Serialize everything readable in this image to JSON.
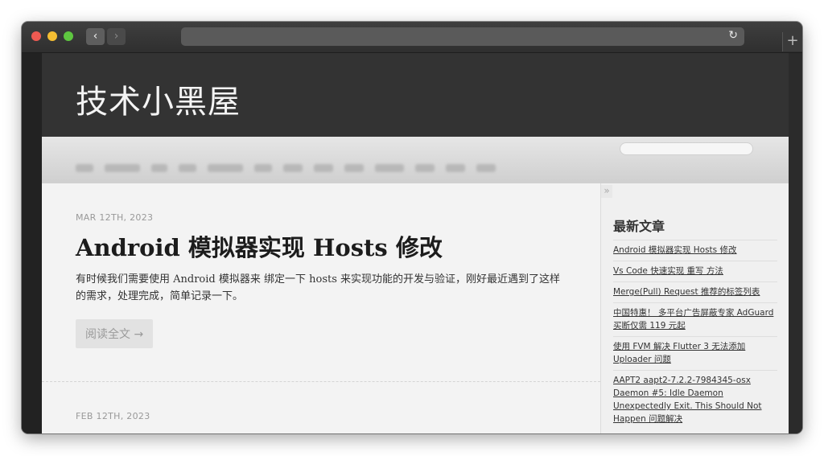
{
  "browser": {
    "back_glyph": "‹",
    "forward_glyph": "›",
    "reload_glyph": "↻",
    "new_tab_glyph": "+",
    "address": ""
  },
  "site": {
    "title": "技术小黑屋"
  },
  "posts": [
    {
      "date": "MAR 12TH, 2023",
      "title": "Android 模拟器实现 Hosts 修改",
      "excerpt": "有时候我们需要使用 Android 模拟器来 绑定一下 hosts 来实现功能的开发与验证，刚好最近遇到了这样的需求，处理完成，简单记录一下。",
      "read_more": "阅读全文 →"
    },
    {
      "date": "FEB 12TH, 2023"
    }
  ],
  "sidebar": {
    "collapse_glyph": "»",
    "heading": "最新文章",
    "recent": [
      "Android 模拟器实现 Hosts 修改",
      "Vs Code 快速实现 重写 方法",
      "Merge(Pull) Request 推荐的标签列表",
      "中国特惠！ 多平台广告屏蔽专家 AdGuard 买断仅需 119 元起",
      "使用 FVM 解决 Flutter 3 无法添加 Uploader 问题",
      "AAPT2 aapt2-7.2.2-7984345-osx Daemon #5: Idle Daemon Unexpectedly Exit. This Should Not Happen 问题解决"
    ]
  },
  "colors": {
    "header_bg": "#333333",
    "page_bg": "#f2f2f2",
    "traffic_red": "#ee5a52",
    "traffic_yellow": "#f4bd32",
    "traffic_green": "#5ec640"
  }
}
